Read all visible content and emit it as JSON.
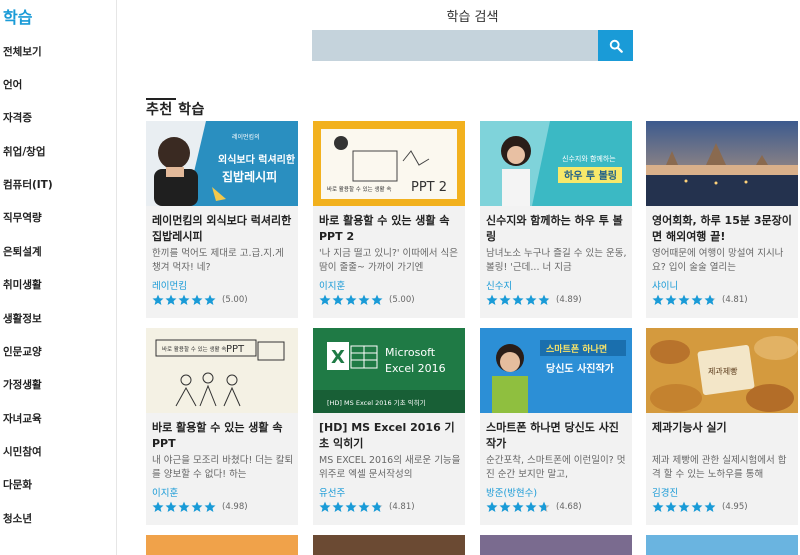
{
  "sidebar": {
    "title": "학습",
    "items": [
      {
        "label": "전체보기"
      },
      {
        "label": "언어"
      },
      {
        "label": "자격증"
      },
      {
        "label": "취업/창업"
      },
      {
        "label": "컴퓨터(IT)"
      },
      {
        "label": "직무역량"
      },
      {
        "label": "은퇴설계"
      },
      {
        "label": "취미생활"
      },
      {
        "label": "생활정보"
      },
      {
        "label": "인문교양"
      },
      {
        "label": "가정생활"
      },
      {
        "label": "자녀교육"
      },
      {
        "label": "시민참여"
      },
      {
        "label": "다문화"
      },
      {
        "label": "청소년"
      }
    ]
  },
  "search": {
    "label": "학습 검색",
    "value": "",
    "icon": "search-icon"
  },
  "section": {
    "title": "추천 학습"
  },
  "courses": [
    {
      "title": "레이먼킴의 외식보다 럭셔리한 집밥레시피",
      "description": "한끼를 먹어도 제대로 고.급.지.게 챙겨 먹자! 네?",
      "author": "레이먼킴",
      "rating": 5.0,
      "score": "(5.00)",
      "thumb": {
        "bg": "#2a8fc0",
        "line1": "외식보다 럭셔리한",
        "line2": "집밥레시피",
        "tag": "레이먼킴의"
      }
    },
    {
      "title": "바로 활용할 수 있는 생활 속 PPT 2",
      "description": "'나 지금 떨고 있니?' 이따에서 식은땀이 줄줄~ 가까이 가기엔",
      "author": "이지훈",
      "rating": 5.0,
      "score": "(5.00)",
      "thumb": {
        "bg": "#f2b11e",
        "caption": "바로 활용할 수 있는 생활 속",
        "big": "PPT 2"
      }
    },
    {
      "title": "신수지와 함께하는 하우 투 볼링",
      "description": "남녀노소 누구나 즐길 수 있는 운동, 볼링! '근데... 너 지금",
      "author": "신수지",
      "rating": 4.89,
      "score": "(4.89)",
      "thumb": {
        "bg": "#3bb9c4",
        "line1": "신수지와 함께하는",
        "line2": "하우 투 볼링"
      }
    },
    {
      "title": "영어회화, 하루 15분 3문장이면 해외여행 끝!",
      "description": "영어때문에 여행이 망설여 지시나요? 입이 술술 열리는",
      "author": "샤이니",
      "rating": 4.81,
      "score": "(4.81)",
      "thumb": {
        "bg": "#7e93b8"
      }
    },
    {
      "title": "바로 활용할 수 있는 생활 속 PPT",
      "description": "내 야근을 모조리 바쳤다! 더는 칼퇴를 양보할 수 없다! 하는",
      "author": "이지훈",
      "rating": 4.98,
      "score": "(4.98)",
      "thumb": {
        "bg": "#f4f1e4",
        "caption": "바로 활용할 수 있는 생활 속",
        "big": "PPT"
      }
    },
    {
      "title": "[HD] MS Excel 2016 기초 익히기",
      "description": "MS EXCEL 2016의 새로운 기능을 위주로 엑셀 문서작성의",
      "author": "유선주",
      "rating": 4.81,
      "score": "(4.81)",
      "thumb": {
        "bg": "#1f7a45",
        "line1": "Microsoft",
        "line2": "Excel 2016",
        "caption": "[HD] MS Excel 2016 기초 익히기"
      }
    },
    {
      "title": "스마트폰 하나면 당신도 사진작가",
      "description": "순간포착, 스마트폰에 이런일이? 멋진 순간 보지만 말고,",
      "author": "방준(방현수)",
      "rating": 4.68,
      "score": "(4.68)",
      "thumb": {
        "bg": "#2c8fd6",
        "line1": "스마트폰 하나면",
        "line2": "당신도 사진작가"
      }
    },
    {
      "title": "제과기능사 실기",
      "description": "제과 제빵에 관한 실제시험에서 합격 할 수 있는 노하우를 통해",
      "author": "김경진",
      "rating": 4.95,
      "score": "(4.95)",
      "thumb": {
        "bg": "#d49a3e",
        "line1": "제과제빵"
      }
    }
  ],
  "colors": {
    "accent": "#1a9bd7",
    "star": "#1a9bd7",
    "search_bg": "#c5d3dc",
    "card_bg": "#f2f2f2"
  }
}
